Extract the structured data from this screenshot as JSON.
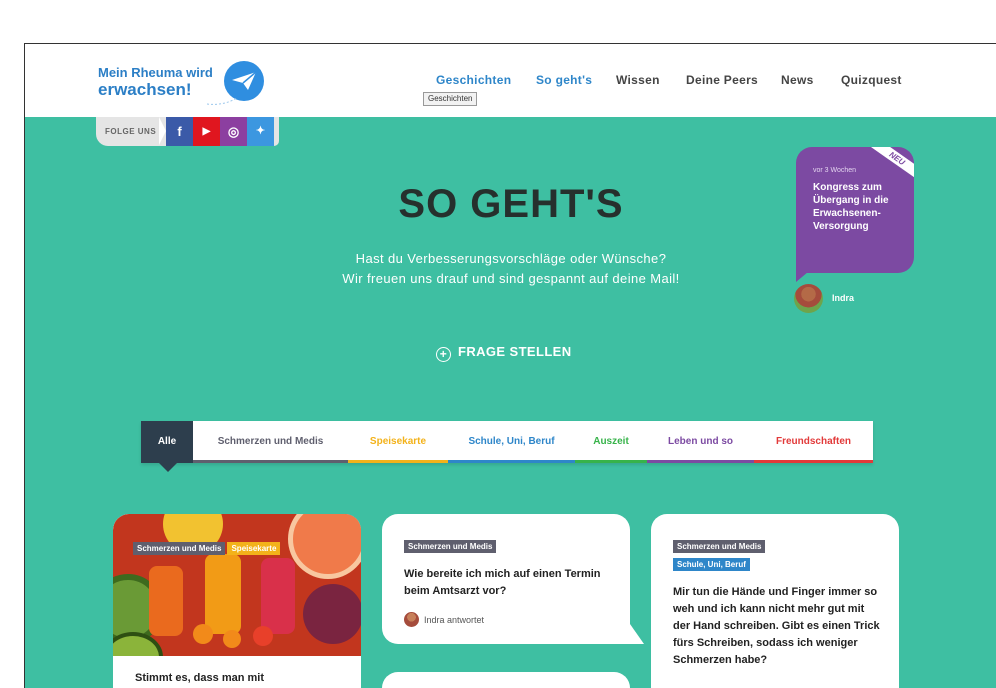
{
  "header": {
    "logo_line1": "Mein Rheuma wird",
    "logo_line2": "erwachsen!",
    "nav": [
      "Geschichten",
      "So geht's",
      "Wissen",
      "Deine Peers",
      "News",
      "Quizquest"
    ],
    "tooltip": "Geschichten"
  },
  "social": {
    "label": "FOLGE UNS",
    "buttons": [
      {
        "name": "facebook",
        "glyph": "f",
        "color": "#3b5aa8"
      },
      {
        "name": "youtube",
        "glyph": "▶",
        "color": "#e0161f"
      },
      {
        "name": "instagram",
        "glyph": "◎",
        "color": "#8c3fa0"
      },
      {
        "name": "twitter",
        "glyph": "✦",
        "color": "#3c97e0"
      }
    ]
  },
  "hero": {
    "title": "SO GEHT'S",
    "subtitle_line1": "Hast du Verbesserungsvorschläge oder Wünsche?",
    "subtitle_line2": "Wir freuen uns drauf und sind gespannt auf deine Mail!",
    "ask_label": "FRAGE STELLEN"
  },
  "news": {
    "badge": "NEU",
    "time": "vor 3 Wochen",
    "title": "Kongress zum Übergang in die Erwachsenen-Versorgung",
    "author": "Indra"
  },
  "tabs": [
    {
      "label": "Alle",
      "color": "#2d3e4d"
    },
    {
      "label": "Schmerzen und Medis",
      "color": "#5f5f6e"
    },
    {
      "label": "Speisekarte",
      "color": "#f3b21a"
    },
    {
      "label": "Schule, Uni, Beruf",
      "color": "#2e86c9"
    },
    {
      "label": "Auszeit",
      "color": "#37b34a"
    },
    {
      "label": "Leben und so",
      "color": "#7c4aa2"
    },
    {
      "label": "Freundschaften",
      "color": "#e23a3a"
    }
  ],
  "cards": [
    {
      "tags": [
        "Schmerzen und Medis",
        "Speisekarte"
      ],
      "question": "Stimmt es, dass man mit"
    },
    {
      "tags": [
        "Schmerzen und Medis"
      ],
      "question": "Wie bereite ich mich auf einen Termin beim Amtsarzt vor?",
      "answer": "Indra antwortet"
    },
    {
      "tags": [
        "Schmerzen und Medis",
        "Schule, Uni, Beruf"
      ],
      "question": "Mir tun die Hände und Finger immer so weh und ich kann nicht mehr gut mit der Hand schreiben. Gibt es einen Trick fürs Schreiben, sodass ich weniger Schmerzen habe?"
    }
  ]
}
